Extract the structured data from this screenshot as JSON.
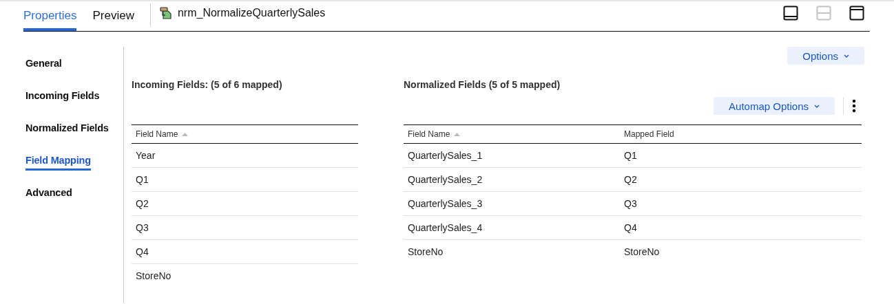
{
  "tabs": [
    {
      "label": "Properties",
      "selected": true
    },
    {
      "label": "Preview",
      "selected": false
    }
  ],
  "object_name": "nrm_NormalizeQuarterlySales",
  "view_buttons": [
    {
      "kind": "bottom",
      "disabled": false
    },
    {
      "kind": "split",
      "disabled": true
    },
    {
      "kind": "top",
      "disabled": false
    }
  ],
  "sidebar": {
    "items": [
      {
        "label": "General",
        "selected": false
      },
      {
        "label": "Incoming Fields",
        "selected": false
      },
      {
        "label": "Normalized Fields",
        "selected": false
      },
      {
        "label": "Field Mapping",
        "selected": true
      },
      {
        "label": "Advanced",
        "selected": false
      }
    ]
  },
  "options_button": "Options",
  "incoming": {
    "title": "Incoming Fields: (5 of 6 mapped)",
    "columns": [
      "Field Name"
    ],
    "rows": [
      [
        "Year"
      ],
      [
        "Q1"
      ],
      [
        "Q2"
      ],
      [
        "Q3"
      ],
      [
        "Q4"
      ],
      [
        "StoreNo"
      ]
    ]
  },
  "normalized": {
    "title": "Normalized Fields (5 of 5 mapped)",
    "automap_button": "Automap Options",
    "columns": [
      "Field Name",
      "Mapped Field"
    ],
    "rows": [
      [
        "QuarterlySales_1",
        "Q1"
      ],
      [
        "QuarterlySales_2",
        "Q2"
      ],
      [
        "QuarterlySales_3",
        "Q3"
      ],
      [
        "QuarterlySales_4",
        "Q4"
      ],
      [
        "StoreNo",
        "StoreNo"
      ]
    ]
  }
}
